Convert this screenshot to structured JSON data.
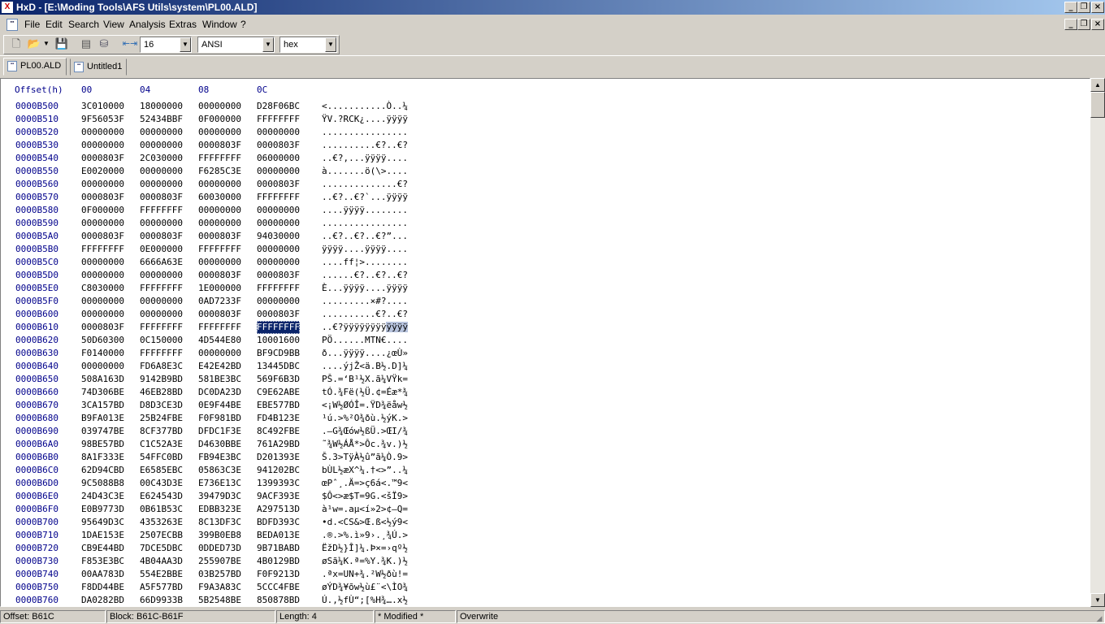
{
  "window": {
    "app_icon": "hxd-icon",
    "title": "HxD - [E:\\Moding Tools\\AFS Utils\\system\\PL00.ALD]",
    "controls": [
      "minimize",
      "maximize",
      "close"
    ]
  },
  "menu": {
    "items": [
      "File",
      "Edit",
      "Search",
      "View",
      "Analysis",
      "Extras",
      "Window",
      "?"
    ]
  },
  "toolbar": {
    "buttons": [
      "new-file-icon",
      "open-file-icon",
      "save-icon",
      "ram-icon",
      "disk-icon",
      "columns-icon"
    ],
    "bytes_per_row": "16",
    "charset": "ANSI",
    "offset_base": "hex"
  },
  "tabs": [
    {
      "label": "PL00.ALD",
      "active": true
    },
    {
      "label": "Untitled1",
      "active": false
    }
  ],
  "hex_header": {
    "offset_label": "Offset(h)",
    "columns": [
      "00",
      "04",
      "08",
      "0C"
    ]
  },
  "rows": [
    {
      "offset": "0000B500",
      "hex": [
        "3C010000",
        "18000000",
        "00000000",
        "D28F06BC"
      ],
      "ascii": "<...........Ò..¼"
    },
    {
      "offset": "0000B510",
      "hex": [
        "9F56053F",
        "52434BBF",
        "0F000000",
        "FFFFFFFF"
      ],
      "ascii": "ŸV.?RCK¿....ÿÿÿÿ"
    },
    {
      "offset": "0000B520",
      "hex": [
        "00000000",
        "00000000",
        "00000000",
        "00000000"
      ],
      "ascii": "................"
    },
    {
      "offset": "0000B530",
      "hex": [
        "00000000",
        "00000000",
        "0000803F",
        "0000803F"
      ],
      "ascii": "..........€?..€?"
    },
    {
      "offset": "0000B540",
      "hex": [
        "0000803F",
        "2C030000",
        "FFFFFFFF",
        "06000000"
      ],
      "ascii": "..€?,...ÿÿÿÿ...."
    },
    {
      "offset": "0000B550",
      "hex": [
        "E0020000",
        "00000000",
        "F6285C3E",
        "00000000"
      ],
      "ascii": "à.......ö(\\>...."
    },
    {
      "offset": "0000B560",
      "hex": [
        "00000000",
        "00000000",
        "00000000",
        "0000803F"
      ],
      "ascii": "..............€?"
    },
    {
      "offset": "0000B570",
      "hex": [
        "0000803F",
        "0000803F",
        "60030000",
        "FFFFFFFF"
      ],
      "ascii": "..€?..€?`...ÿÿÿÿ"
    },
    {
      "offset": "0000B580",
      "hex": [
        "0F000000",
        "FFFFFFFF",
        "00000000",
        "00000000"
      ],
      "ascii": "....ÿÿÿÿ........"
    },
    {
      "offset": "0000B590",
      "hex": [
        "00000000",
        "00000000",
        "00000000",
        "00000000"
      ],
      "ascii": "................"
    },
    {
      "offset": "0000B5A0",
      "hex": [
        "0000803F",
        "0000803F",
        "0000803F",
        "94030000"
      ],
      "ascii": "..€?..€?..€?”..."
    },
    {
      "offset": "0000B5B0",
      "hex": [
        "FFFFFFFF",
        "0E000000",
        "FFFFFFFF",
        "00000000"
      ],
      "ascii": "ÿÿÿÿ....ÿÿÿÿ...."
    },
    {
      "offset": "0000B5C0",
      "hex": [
        "00000000",
        "6666A63E",
        "00000000",
        "00000000"
      ],
      "ascii": "....ff¦>........"
    },
    {
      "offset": "0000B5D0",
      "hex": [
        "00000000",
        "00000000",
        "0000803F",
        "0000803F"
      ],
      "ascii": "......€?..€?..€?"
    },
    {
      "offset": "0000B5E0",
      "hex": [
        "C8030000",
        "FFFFFFFF",
        "1E000000",
        "FFFFFFFF"
      ],
      "ascii": "È...ÿÿÿÿ....ÿÿÿÿ"
    },
    {
      "offset": "0000B5F0",
      "hex": [
        "00000000",
        "00000000",
        "0AD7233F",
        "00000000"
      ],
      "ascii": ".........×#?...."
    },
    {
      "offset": "0000B600",
      "hex": [
        "00000000",
        "00000000",
        "0000803F",
        "0000803F"
      ],
      "ascii": "..........€?..€?"
    },
    {
      "offset": "0000B610",
      "hex": [
        "0000803F",
        "FFFFFFFF",
        "FFFFFFFF",
        "FFFFFFFF"
      ],
      "ascii": "..€?ÿÿÿÿÿÿÿÿ",
      "ascii_sel": "ÿÿÿÿ",
      "selected": true
    },
    {
      "offset": "0000B620",
      "hex": [
        "50D60300",
        "0C150000",
        "4D544E80",
        "10001600"
      ],
      "ascii": "PÖ......MTN€...."
    },
    {
      "offset": "0000B630",
      "hex": [
        "F0140000",
        "FFFFFFFF",
        "00000000",
        "BF9CD9BB"
      ],
      "ascii": "ð...ÿÿÿÿ....¿œÙ»"
    },
    {
      "offset": "0000B640",
      "hex": [
        "00000000",
        "FD6A8E3C",
        "E42E42BD",
        "13445DBC"
      ],
      "ascii": "....ýjŽ<ä.B½.D]¼"
    },
    {
      "offset": "0000B650",
      "hex": [
        "508A163D",
        "9142B9BD",
        "581BE3BC",
        "569F6B3D"
      ],
      "ascii": "PŠ.=‘B¹½X.ã¼VŸk="
    },
    {
      "offset": "0000B660",
      "hex": [
        "74D306BE",
        "46EB28BD",
        "DC0DA23D",
        "C9E62ABE"
      ],
      "ascii": "tÓ.¾Fë(½Ü.¢=Éæ*¾"
    },
    {
      "offset": "0000B670",
      "hex": [
        "3CA157BD",
        "D8D3CE3D",
        "0E9F44BE",
        "EBE577BD"
      ],
      "ascii": "<¡W½ØÓÎ=.ŸD¾ëåw½"
    },
    {
      "offset": "0000B680",
      "hex": [
        "B9FA013E",
        "25B24FBE",
        "F0F981BD",
        "FD4B123E"
      ],
      "ascii": "¹ú.>%²O¾ðù.½ýK.>"
    },
    {
      "offset": "0000B690",
      "hex": [
        "039747BE",
        "8CF377BD",
        "DFDC1F3E",
        "8C492FBE"
      ],
      "ascii": ".—G¾Œów½ßÜ.>ŒI/¾"
    },
    {
      "offset": "0000B6A0",
      "hex": [
        "98BE57BD",
        "C1C52A3E",
        "D4630BBE",
        "761A29BD"
      ],
      "ascii": "˜¾W½ÁÅ*>Ôc.¾v.)½"
    },
    {
      "offset": "0000B6B0",
      "hex": [
        "8A1F333E",
        "54FFC0BD",
        "FB94E3BC",
        "D201393E"
      ],
      "ascii": "Š.3>TÿÀ½û”ã¼Ò.9>"
    },
    {
      "offset": "0000B6C0",
      "hex": [
        "62D94CBD",
        "E6585EBC",
        "05863C3E",
        "941202BC"
      ],
      "ascii": "bÙL½æX^¼.†<>”..¼"
    },
    {
      "offset": "0000B6D0",
      "hex": [
        "9C5088B8",
        "00C43D3E",
        "E736E13C",
        "1399393C"
      ],
      "ascii": "œPˆ¸.Ä=>ç6á<.™9<"
    },
    {
      "offset": "0000B6E0",
      "hex": [
        "24D43C3E",
        "E624543D",
        "39479D3C",
        "9ACF393E"
      ],
      "ascii": "$Ô<>æ$T=9G.<šÏ9>"
    },
    {
      "offset": "0000B6F0",
      "hex": [
        "E0B9773D",
        "0B61B53C",
        "EDBB323E",
        "A297513D"
      ],
      "ascii": "à¹w=.aµ<í»2>¢—Q="
    },
    {
      "offset": "0000B700",
      "hex": [
        "95649D3C",
        "4353263E",
        "8C13DF3C",
        "BDFD393C"
      ],
      "ascii": "•d.<CS&>Œ.ß<½ý9<"
    },
    {
      "offset": "0000B710",
      "hex": [
        "1DAE153E",
        "2507ECBB",
        "399B0EB8",
        "BEDA013E"
      ],
      "ascii": ".®.>%.ì»9›.¸¾Ú.>"
    },
    {
      "offset": "0000B720",
      "hex": [
        "CB9E44BD",
        "7DCE5DBC",
        "0DDED73D",
        "9B71BABD"
      ],
      "ascii": "ËžD½}Î]¼.Þ×=›qº½"
    },
    {
      "offset": "0000B730",
      "hex": [
        "F853E3BC",
        "4B04AA3D",
        "255907BE",
        "4B0129BD"
      ],
      "ascii": "øSã¼K.ª=%Y.¾K.)½"
    },
    {
      "offset": "0000B740",
      "hex": [
        "00AA783D",
        "554E2BBE",
        "03B257BD",
        "F0F9213D"
      ],
      "ascii": ".ªx=UN+¾.²W½ðù!="
    },
    {
      "offset": "0000B750",
      "hex": [
        "F8DD44BE",
        "A5F577BD",
        "F9A3A83C",
        "5CCC4FBE"
      ],
      "ascii": "øÝD¾¥õw½ù£¨<\\ÌO¾"
    },
    {
      "offset": "0000B760",
      "hex": [
        "DA0282BD",
        "66D9933B",
        "5B2548BE",
        "850878BD"
      ],
      "ascii": "Ú.‚½fÙ“;[%H¾….x½"
    }
  ],
  "status": {
    "offset": "Offset: B61C",
    "block": "Block: B61C-B61F",
    "length": "Length: 4",
    "modified": "* Modified *",
    "mode": "Overwrite"
  }
}
